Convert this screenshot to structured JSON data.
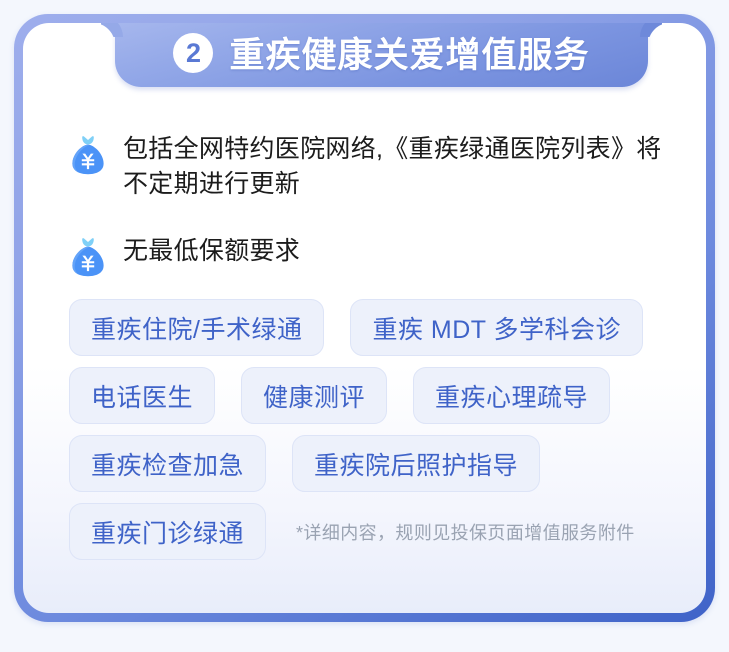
{
  "card": {
    "header": {
      "badge_number": "2",
      "title": "重疾健康关爱增值服务"
    },
    "bullets": [
      {
        "icon": "money-bag-icon",
        "text": "包括全网特约医院网络,《重疾绿通医院列表》将不定期进行更新"
      },
      {
        "icon": "money-bag-icon",
        "text": "无最低保额要求"
      }
    ],
    "chip_rows": [
      {
        "chips": [
          "重疾住院/手术绿通",
          "重疾 MDT 多学科会诊"
        ]
      },
      {
        "chips": [
          "电话医生",
          "健康测评",
          "重疾心理疏导"
        ]
      },
      {
        "chips": [
          "重疾检查加急",
          "重疾院后照护指导"
        ]
      },
      {
        "chips": [
          "重疾门诊绿通"
        ]
      }
    ],
    "footnote": "*详细内容，规则见投保页面增值服务附件"
  },
  "colors": {
    "page_background": "#f4f7fd",
    "card_border_light": "#9eaeec",
    "card_border_dark": "#3f63c8",
    "banner_gradient_start": "#93a8e8",
    "banner_gradient_end": "#6b86d8",
    "badge_text": "#5a79d4",
    "title_text": "#ffffff",
    "body_text": "#1c1c1c",
    "chip_background": "#edf1fb",
    "chip_border": "#dde4f7",
    "chip_text": "#3f63c8",
    "footnote_text": "#9aa3b2",
    "bag_body": "#4b93f7",
    "bag_knot": "#7fd0f7"
  }
}
